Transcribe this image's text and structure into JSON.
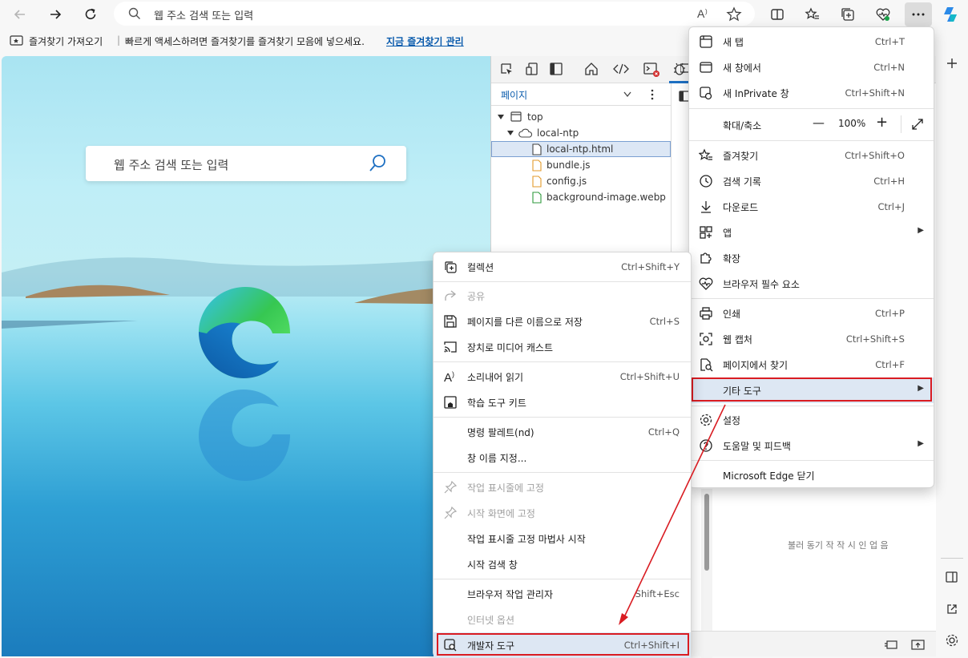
{
  "address_bar": {
    "placeholder": "웹 주소 검색 또는 입력"
  },
  "favorites_bar": {
    "import_label": "즐겨찾기 가져오기",
    "hint": "빠르게 액세스하려면 즐겨찾기를 즐겨찾기 모음에 넣으세요.",
    "manage_link": "지금 즐겨찾기 관리"
  },
  "ntp": {
    "search_placeholder": "웹 주소 검색 또는 입력"
  },
  "devtools": {
    "nav_label": "페이지",
    "tree": [
      "top",
      "local-ntp",
      "local-ntp.html",
      "bundle.js",
      "config.js",
      "background-image.webp"
    ],
    "lower_text": "불러 동기 작 작 시 인 업 음"
  },
  "main_menu": {
    "new_tab": {
      "label": "새 탭",
      "shortcut": "Ctrl+T"
    },
    "new_window": {
      "label": "새 창에서",
      "shortcut": "Ctrl+N"
    },
    "new_inprivate": {
      "label": "새 InPrivate 창",
      "shortcut": "Ctrl+Shift+N"
    },
    "zoom": {
      "label": "확대/축소",
      "value": "100%",
      "minus": "—",
      "plus": "+"
    },
    "favorites": {
      "label": "즐겨찾기",
      "shortcut": "Ctrl+Shift+O"
    },
    "history": {
      "label": "검색 기록",
      "shortcut": "Ctrl+H"
    },
    "downloads": {
      "label": "다운로드",
      "shortcut": "Ctrl+J"
    },
    "apps": {
      "label": "앱"
    },
    "extensions": {
      "label": "확장"
    },
    "browser_essentials": {
      "label": "브라우저 필수 요소"
    },
    "print": {
      "label": "인쇄",
      "shortcut": "Ctrl+P"
    },
    "web_capture": {
      "label": "웹 캡처",
      "shortcut": "Ctrl+Shift+S"
    },
    "find": {
      "label": "페이지에서 찾기",
      "shortcut": "Ctrl+F"
    },
    "more_tools": {
      "label": "기타 도구"
    },
    "settings": {
      "label": "설정"
    },
    "help": {
      "label": "도움말 및 피드백"
    },
    "close": {
      "label": "Microsoft Edge 닫기"
    }
  },
  "sub_menu": {
    "collections": {
      "label": "컬렉션",
      "shortcut": "Ctrl+Shift+Y"
    },
    "share": {
      "label": "공유"
    },
    "save_as": {
      "label": "페이지를 다른 이름으로 저장",
      "shortcut": "Ctrl+S"
    },
    "cast": {
      "label": "장치로 미디어 캐스트"
    },
    "read_aloud": {
      "label": "소리내어 읽기",
      "shortcut": "Ctrl+Shift+U"
    },
    "learning_toolkit": {
      "label": "학습 도구 키트"
    },
    "command_palette": {
      "label": "명령 팔레트(nd)",
      "shortcut": "Ctrl+Q"
    },
    "name_window": {
      "label": "창 이름 지정..."
    },
    "pin_taskbar": {
      "label": "작업 표시줄에 고정"
    },
    "pin_start": {
      "label": "시작 화면에 고정"
    },
    "taskbar_wizard": {
      "label": "작업 표시줄 고정 마법사 시작"
    },
    "start_search": {
      "label": "시작 검색 창"
    },
    "task_manager": {
      "label": "브라우저 작업 관리자",
      "shortcut": "Shift+Esc"
    },
    "internet_options": {
      "label": "인터넷 옵션"
    },
    "dev_tools": {
      "label": "개발자 도구",
      "shortcut": "Ctrl+Shift+I"
    }
  },
  "colors": {
    "highlight": "#dde7f3",
    "annotation_red": "#d91c22",
    "link": "#0b5cad"
  }
}
